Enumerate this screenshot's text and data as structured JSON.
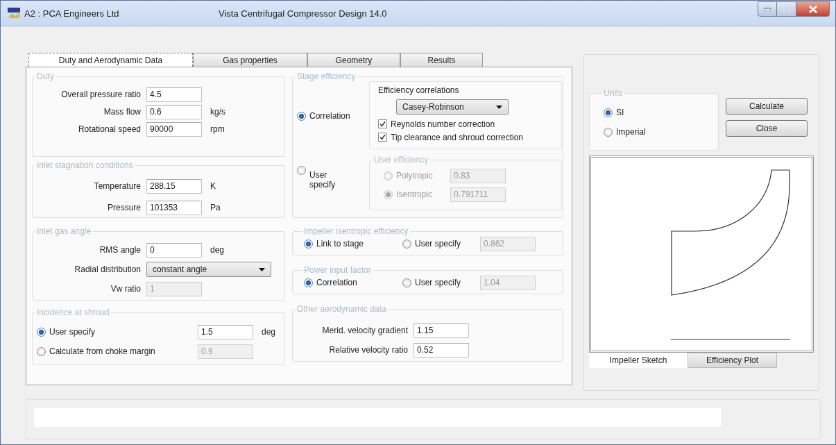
{
  "window": {
    "title_left": "A2 : PCA Engineers Ltd",
    "title": "Vista Centrifugal Compressor Design 14.0"
  },
  "tabs": [
    {
      "label": "Duty and Aerodynamic Data",
      "selected": true
    },
    {
      "label": "Gas properties",
      "selected": false
    },
    {
      "label": "Geometry",
      "selected": false
    },
    {
      "label": "Results",
      "selected": false
    }
  ],
  "duty": {
    "title": "Duty",
    "fields": [
      {
        "label": "Overall pressure ratio",
        "value": "4.5"
      },
      {
        "label": "Mass flow",
        "value": "0.6",
        "unit": "kg/s"
      },
      {
        "label": "Rotational speed",
        "value": "90000",
        "unit": "rpm"
      }
    ]
  },
  "inlet_stagnation": {
    "title": "Inlet stagnation conditions",
    "fields": [
      {
        "label": "Temperature",
        "value": "288.15",
        "unit": "K"
      },
      {
        "label": "Pressure",
        "value": "101353",
        "unit": "Pa"
      }
    ]
  },
  "inlet_gas_angle": {
    "title": "Inlet gas angle",
    "fields": [
      {
        "kind": "text",
        "label": "RMS angle",
        "value": "0",
        "unit": "deg"
      },
      {
        "kind": "dropdown",
        "label": "Radial distribution",
        "value": "constant angle"
      },
      {
        "kind": "text",
        "label": "Vw ratio",
        "value": "1",
        "disabled": true
      }
    ]
  },
  "incidence": {
    "title": "Incidence at shroud",
    "options": [
      {
        "label": "User specify",
        "selected": true,
        "value": "1.5",
        "unit": "deg"
      },
      {
        "label": "Calculate from choke margin",
        "selected": false,
        "value": "0.9"
      }
    ]
  },
  "stage_efficiency": {
    "title": "Stage efficiency",
    "options": [
      {
        "label": "Correlation",
        "selected": true
      },
      {
        "label": "User specify",
        "selected": false
      }
    ],
    "correlations": {
      "title": "Efficiency correlations",
      "method": "Casey-Robinson",
      "checks": [
        {
          "label": "Reynolds number correction",
          "checked": true
        },
        {
          "label": "Tip clearance and shroud correction",
          "checked": true
        }
      ]
    },
    "user_efficiency": {
      "title": "User efficiency",
      "disabled": true,
      "options": [
        {
          "label": "Polytropic",
          "selected": false,
          "value": "0.83"
        },
        {
          "label": "Isentropic",
          "selected": true,
          "value": "0.791711"
        }
      ]
    }
  },
  "impeller_efficiency": {
    "title": "Impeller isentropic efficiency",
    "options": [
      {
        "label": "Link to stage",
        "selected": true
      },
      {
        "label": "User specify",
        "selected": false,
        "value": "0.862"
      }
    ]
  },
  "power_input": {
    "title": "Power input factor",
    "options": [
      {
        "label": "Correlation",
        "selected": true
      },
      {
        "label": "User specify",
        "selected": false,
        "value": "1.04"
      }
    ]
  },
  "other_aero": {
    "title": "Other aerodynamic data",
    "fields": [
      {
        "label": "Merid. velocity gradient",
        "value": "1.15"
      },
      {
        "label": "Relative velocity ratio",
        "value": "0.52"
      }
    ]
  },
  "units": {
    "title": "Units",
    "options": [
      {
        "label": "SI",
        "selected": true
      },
      {
        "label": "Imperial",
        "selected": false
      }
    ]
  },
  "buttons": [
    "Calculate",
    "Close"
  ],
  "sketch_tabs": [
    {
      "label": "Impeller Sketch",
      "selected": true
    },
    {
      "label": "Efficiency Plot",
      "selected": false
    }
  ]
}
